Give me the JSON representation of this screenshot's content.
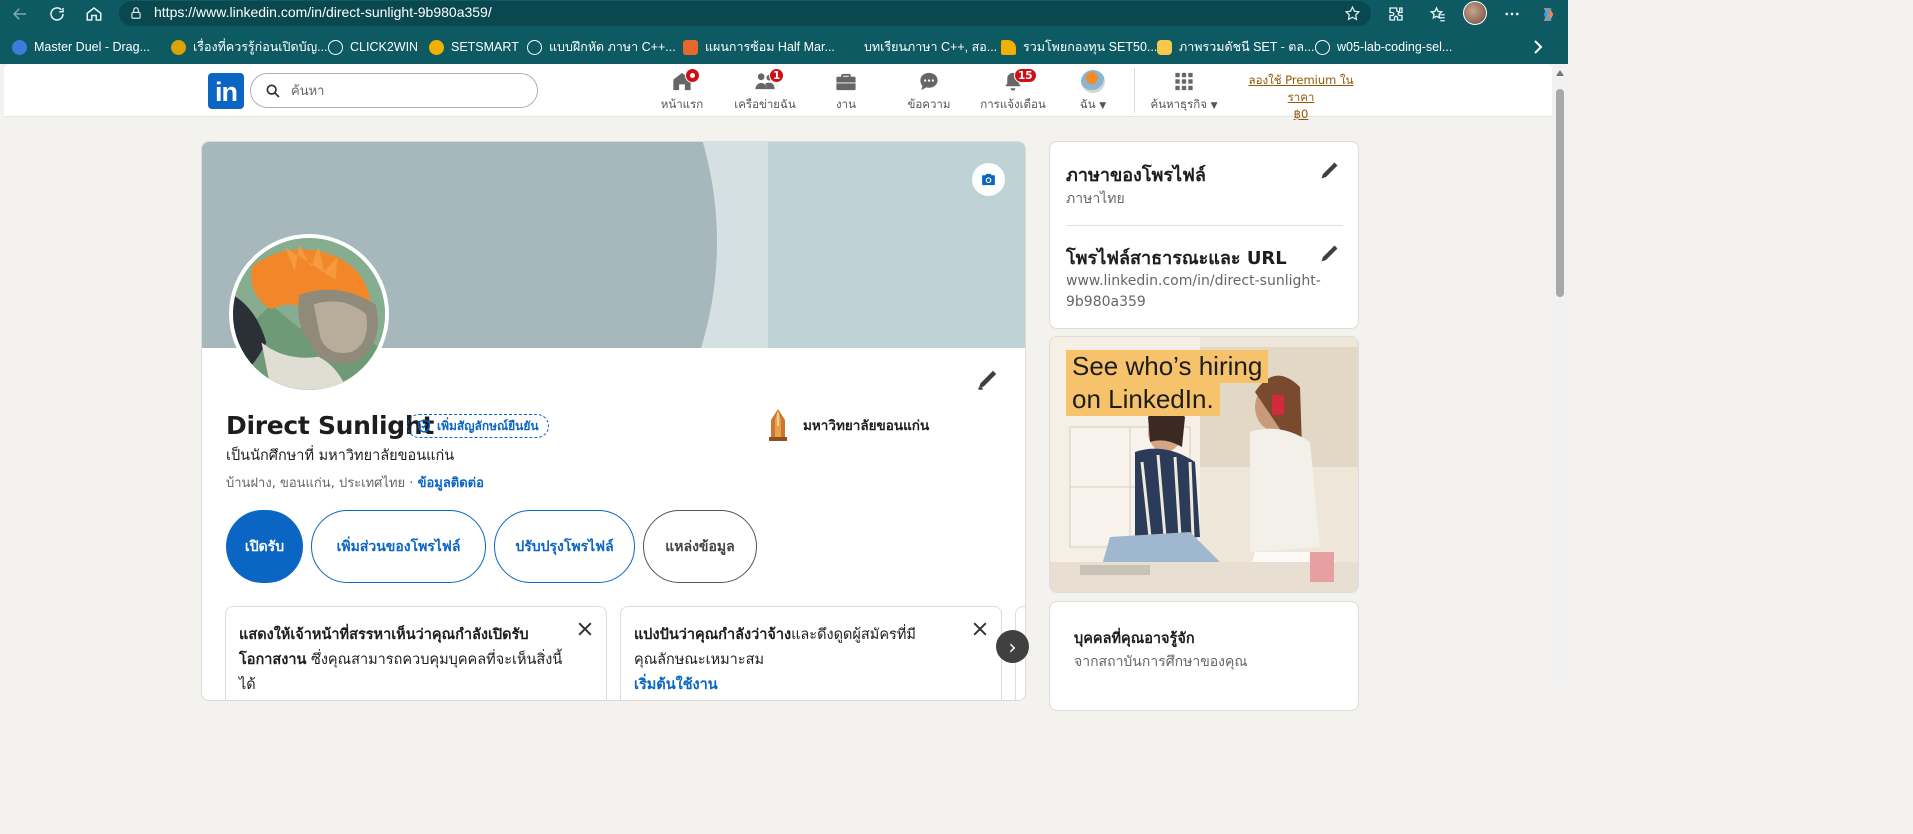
{
  "browser": {
    "url": "https://www.linkedin.com/in/direct-sunlight-9b980a359/",
    "bookmarks": [
      {
        "label": "Master Duel - Drag...",
        "color": "#3b7dd8"
      },
      {
        "label": "เรื่องที่ควรรู้ก่อนเปิดบัญ...",
        "color": "#d9a400"
      },
      {
        "label": "CLICK2WIN",
        "color": "#ffffff"
      },
      {
        "label": "SETSMART",
        "color": "#f2b100"
      },
      {
        "label": "แบบฝึกหัด ภาษา C++...",
        "color": "#ffffff"
      },
      {
        "label": "แผนการซ้อม Half Mar...",
        "color": "#e8672b"
      },
      {
        "label": "บทเรียนภาษา C++, สอ...",
        "color": "#0d5a63"
      },
      {
        "label": "รวมโพยกองทุน SET50...",
        "color": "#f2b100"
      },
      {
        "label": "ภาพรวมดัชนี SET - ตล...",
        "color": "#f6c84b"
      },
      {
        "label": "w05-lab-coding-sel...",
        "color": "#ffffff"
      }
    ]
  },
  "nav": {
    "search_placeholder": "ค้นหา",
    "items": [
      {
        "label": "หน้าแรก",
        "icon": "home-icon",
        "badge": "dot"
      },
      {
        "label": "เครือข่ายฉัน",
        "icon": "network-icon",
        "badge": "1"
      },
      {
        "label": "งาน",
        "icon": "jobs-icon",
        "badge": ""
      },
      {
        "label": "ข้อความ",
        "icon": "messaging-icon",
        "badge": ""
      },
      {
        "label": "การแจ้งเตือน",
        "icon": "bell-icon",
        "badge": "15"
      },
      {
        "label": "ฉัน",
        "icon": "me-avatar",
        "badge": ""
      },
      {
        "label": "ค้นหาธุรกิจ",
        "icon": "grid-icon",
        "badge": ""
      }
    ],
    "premium_line1": "ลองใช้ Premium ในราคา",
    "premium_line2": "฿0"
  },
  "profile": {
    "name": "Direct Sunlight",
    "verify_label": "เพิ่มสัญลักษณ์ยืนยัน",
    "headline": "เป็นนักศึกษาที่ มหาวิทยาลัยขอนแก่น",
    "location": "บ้านฝาง, ขอนแก่น, ประเทศไทย",
    "separator": " · ",
    "contact_label": "ข้อมูลติดต่อ",
    "education": "มหาวิทยาลัยขอนแก่น",
    "buttons": {
      "open_to": "เปิดรับ",
      "add_section": "เพิ่มส่วนของโพรไฟล์",
      "enhance": "ปรับปรุงโพรไฟล์",
      "resources": "แหล่งข้อมูล"
    }
  },
  "recommendations": [
    {
      "bold": "แสดงให้เจ้าหน้าที่สรรหาเห็นว่าคุณกำลังเปิดรับโอกาสงาน",
      "text": " ซึ่งคุณสามารถควบคุมบุคคลที่จะเห็นสิ่งนี้ได้",
      "link": ""
    },
    {
      "bold": "แบ่งปันว่าคุณกำลังว่าจ้าง",
      "text": "และดึงดูดผู้สมัครที่มีคุณลักษณะเหมาะสม",
      "link": "เริ่มต้นใช้งาน"
    }
  ],
  "sidebar": {
    "language_title": "ภาษาของโพรไฟล์",
    "language_value": "ภาษาไทย",
    "url_title": "โพรไฟล์สาธารณะและ URL",
    "url_value": "www.linkedin.com/in/direct-sunlight-9b980a359",
    "ad_line1": "See who’s hiring",
    "ad_line2": "on LinkedIn.",
    "pymk_title": "บุคคลที่คุณอาจรู้จัก",
    "pymk_sub": "จากสถาบันการศึกษาของคุณ"
  },
  "colors": {
    "brand": "#0a66c2",
    "chrome": "#0d5a63",
    "badge": "#cc1016",
    "premium": "#915907"
  }
}
